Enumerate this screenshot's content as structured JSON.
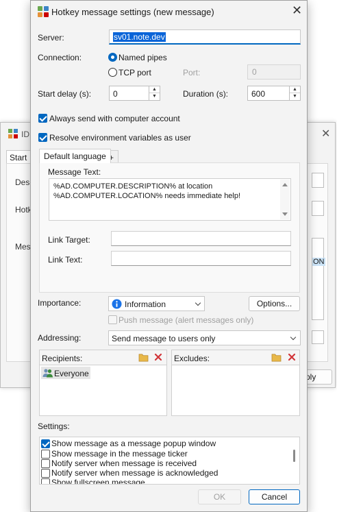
{
  "background_window": {
    "title": "IDE",
    "tab_start": "Start",
    "label_desc": "Desc",
    "label_hotkey": "Hotk",
    "label_message": "Mess",
    "list_fragment": "ON",
    "button_fragment": "ply"
  },
  "dialog": {
    "title": "Hotkey message settings (new message)",
    "server_label": "Server:",
    "server_value": "sv01.note.dev",
    "connection_label": "Connection:",
    "named_pipes_label": "Named pipes",
    "tcp_port_label": "TCP port",
    "port_label": "Port:",
    "port_value": "0",
    "start_delay_label": "Start delay (s):",
    "start_delay_value": "0",
    "duration_label": "Duration (s):",
    "duration_value": "600",
    "always_send_label": "Always send with computer account",
    "resolve_env_label": "Resolve environment variables as user",
    "tabs": [
      "Default language",
      "+"
    ],
    "message_text_label": "Message Text:",
    "message_line1": "%AD.COMPUTER.DESCRIPTION% at location",
    "message_line2": "%AD.COMPUTER.LOCATION% needs immediate help!",
    "link_target_label": "Link Target:",
    "link_text_label": "Link Text:",
    "importance_label": "Importance:",
    "importance_value": "Information",
    "options_button": "Options...",
    "push_message_label": "Push message (alert messages only)",
    "addressing_label": "Addressing:",
    "addressing_value": "Send message to users only",
    "recipients_label": "Recipients:",
    "recipients": [
      "Everyone"
    ],
    "excludes_label": "Excludes:",
    "settings_label": "Settings:",
    "settings_items": [
      {
        "label": "Show message as a message popup window",
        "checked": true
      },
      {
        "label": "Show message in the message ticker",
        "checked": false
      },
      {
        "label": "Notify server when message is received",
        "checked": false
      },
      {
        "label": "Notify server when message is acknowledged",
        "checked": false
      },
      {
        "label": "Show fullscreen message",
        "checked": false
      }
    ],
    "ok_button": "OK",
    "cancel_button": "Cancel"
  },
  "colors": {
    "accent": "#0067c0",
    "info_icon": "#1a73e8",
    "delete_icon": "#d13438",
    "folder_icon": "#e8b84a"
  }
}
